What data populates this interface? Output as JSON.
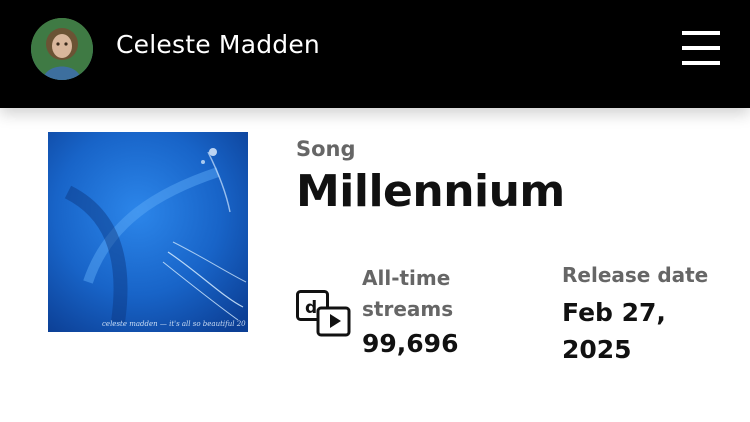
{
  "header": {
    "artist_name": "Celeste Madden",
    "avatar_icon": "artist-avatar",
    "menu_icon": "hamburger-menu-icon"
  },
  "song": {
    "type_label": "Song",
    "title": "Millennium",
    "cover_icon": "album-cover-art",
    "cover_caption": "celeste madden — it's all so beautiful 20"
  },
  "stats": {
    "streams_icon": "music-video-icon",
    "streams_label": "All-time streams",
    "streams_value": "99,696",
    "release_label": "Release date",
    "release_value": "Feb 27, 2025"
  },
  "colors": {
    "header_bg": "#000000",
    "label_gray": "#666666",
    "text_dark": "#111111",
    "cover_blue": "#1e6fd6"
  }
}
